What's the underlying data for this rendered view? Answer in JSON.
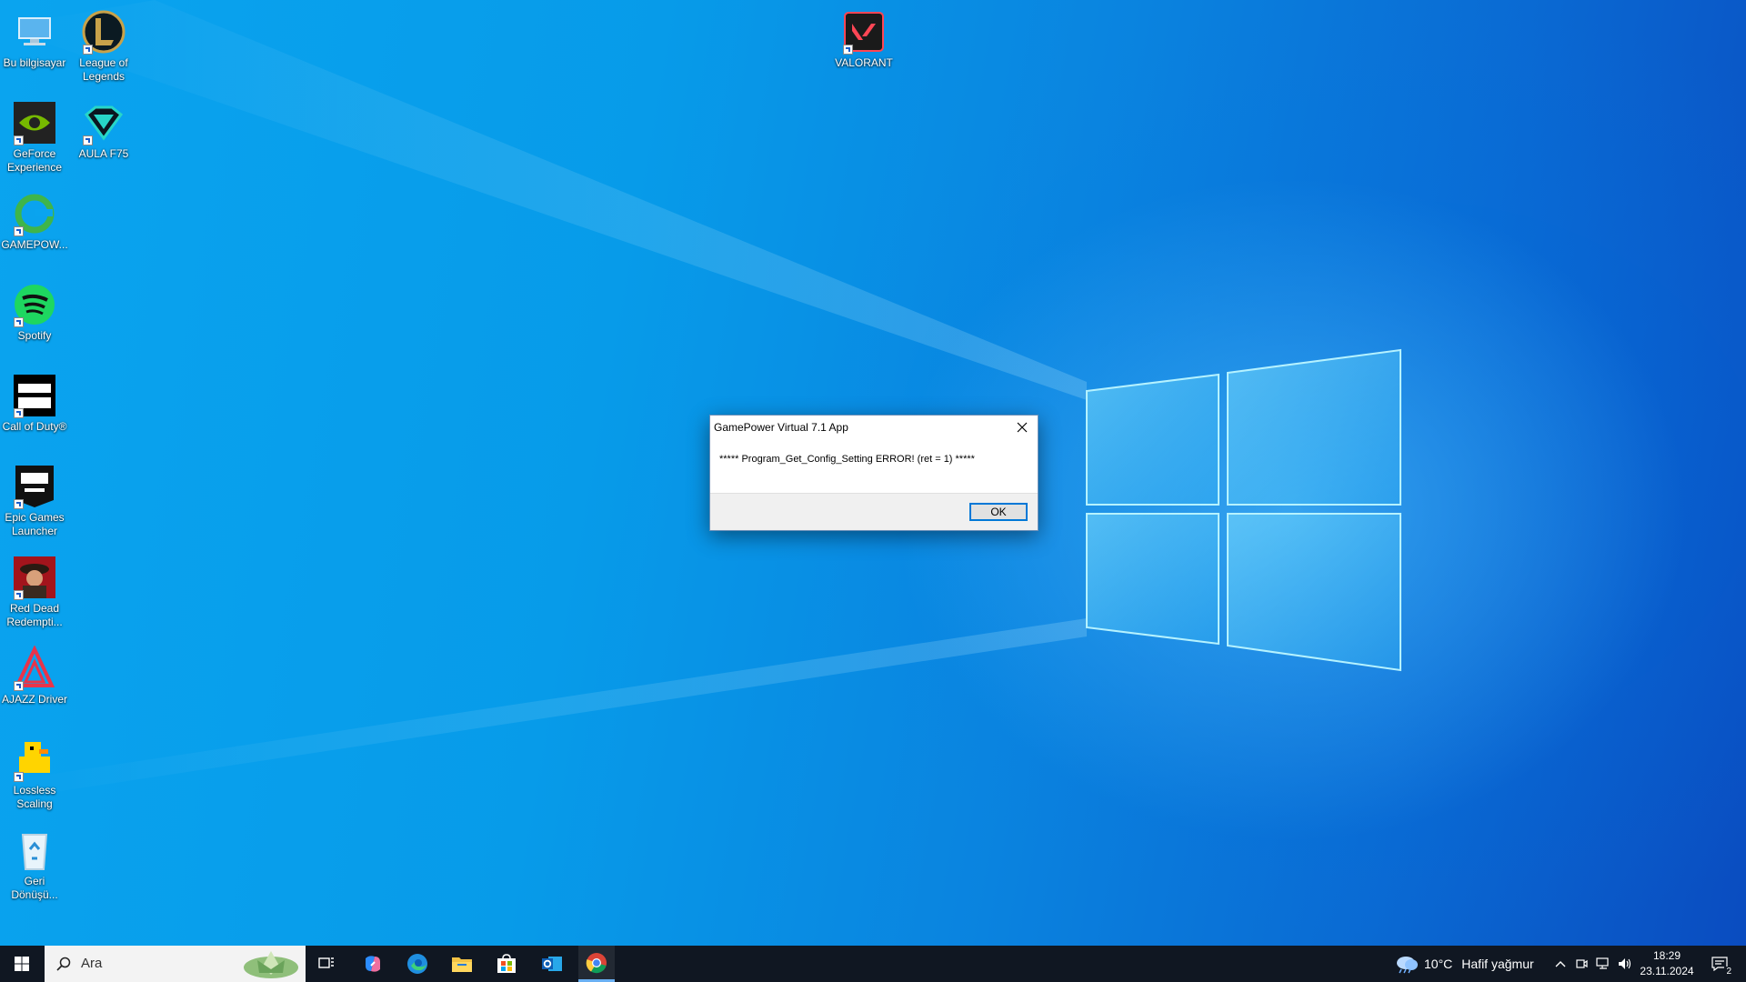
{
  "desktop_icons": [
    {
      "label": "Bu bilgisayar",
      "icon": "this-pc-icon"
    },
    {
      "label": "League of Legends",
      "icon": "league-of-legends-icon"
    },
    {
      "label": "VALORANT",
      "icon": "valorant-icon"
    },
    {
      "label": "GeForce Experience",
      "icon": "geforce-experience-icon"
    },
    {
      "label": "AULA F75",
      "icon": "aula-f75-icon"
    },
    {
      "label": "GAMEPOW...",
      "icon": "gamepower-icon"
    },
    {
      "label": "Spotify",
      "icon": "spotify-icon"
    },
    {
      "label": "Call of Duty®",
      "icon": "call-of-duty-icon"
    },
    {
      "label": "Epic Games Launcher",
      "icon": "epic-games-icon"
    },
    {
      "label": "Red Dead Redempti...",
      "icon": "red-dead-redemption-icon"
    },
    {
      "label": "AJAZZ Driver",
      "icon": "ajazz-driver-icon"
    },
    {
      "label": "Lossless Scaling",
      "icon": "lossless-scaling-icon"
    },
    {
      "label": "Geri Dönüşü...",
      "icon": "recycle-bin-icon"
    }
  ],
  "dialog": {
    "title": "GamePower Virtual 7.1 App",
    "message": "***** Program_Get_Config_Setting ERROR! (ret = 1) *****",
    "ok_label": "OK"
  },
  "taskbar": {
    "search_placeholder": "Ara",
    "apps": [
      "task-view-icon",
      "copilot-icon",
      "edge-icon",
      "file-explorer-icon",
      "store-icon",
      "outlook-icon",
      "chrome-icon"
    ],
    "weather_temp": "10°C",
    "weather_desc": "Hafif yağmur",
    "time": "18:29",
    "date": "23.11.2024",
    "notification_count": "2"
  },
  "colors": {
    "desktop_blue": "#0aa4ef",
    "taskbar": "#101722",
    "accent": "#0078d7"
  }
}
